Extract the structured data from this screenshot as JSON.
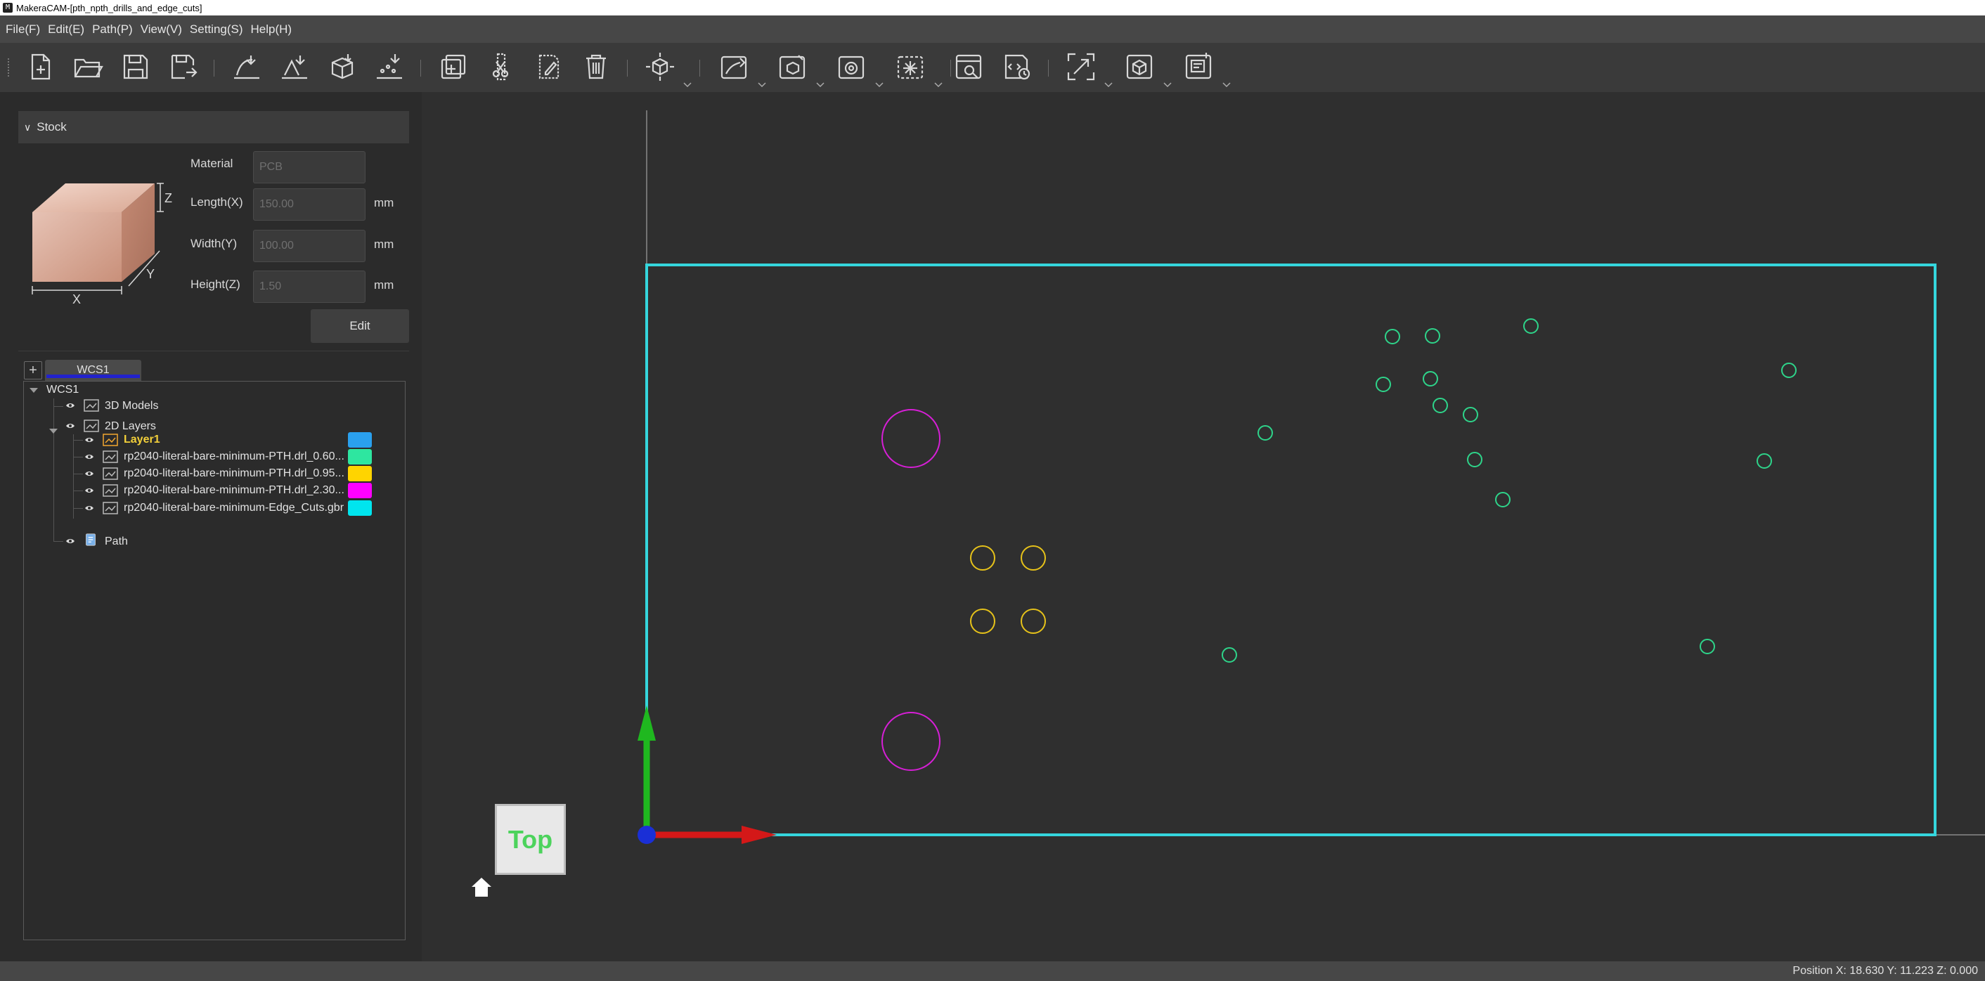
{
  "window": {
    "title": "MakeraCAM-[pth_npth_drills_and_edge_cuts]",
    "icon_label": "M"
  },
  "menu": [
    "File(F)",
    "Edit(E)",
    "Path(P)",
    "View(V)",
    "Setting(S)",
    "Help(H)"
  ],
  "toolbar": {
    "buttons": [
      "new-file",
      "open-file",
      "save",
      "save-as",
      "import-2d",
      "import-arc",
      "import-3d",
      "import-dots",
      "add",
      "cut",
      "edit",
      "delete",
      "transform",
      "2d-path",
      "3d-path",
      "drill",
      "laser",
      "simulate",
      "gcode",
      "fit-view",
      "3d-view",
      "report"
    ]
  },
  "stock": {
    "header": "Stock",
    "axis_labels": {
      "x": "X",
      "y": "Y",
      "z": "Z"
    },
    "fields": [
      {
        "label": "Material",
        "value": "PCB",
        "unit": ""
      },
      {
        "label": "Length(X)",
        "value": "150.00",
        "unit": "mm"
      },
      {
        "label": "Width(Y)",
        "value": "100.00",
        "unit": "mm"
      },
      {
        "label": "Height(Z)",
        "value": "1.50",
        "unit": "mm"
      }
    ],
    "edit_label": "Edit"
  },
  "wcs": {
    "add_label": "+",
    "tab_label": "WCS1"
  },
  "tree": {
    "root": "WCS1",
    "models": "3D Models",
    "layers_group": "2D Layers",
    "layers": [
      {
        "name": "Layer1",
        "color": "#2aa0ee"
      },
      {
        "name": "rp2040-literal-bare-minimum-PTH.drl_0.60...",
        "color": "#2ee6a0"
      },
      {
        "name": "rp2040-literal-bare-minimum-PTH.drl_0.95...",
        "color": "#ffd400"
      },
      {
        "name": "rp2040-literal-bare-minimum-PTH.drl_2.30...",
        "color": "#ff00ff"
      },
      {
        "name": "rp2040-literal-bare-minimum-Edge_Cuts.gbr",
        "color": "#00e5ee"
      }
    ],
    "path": "Path"
  },
  "viewport": {
    "view_label": "Top",
    "edge_color": "#35d6dd",
    "small_holes_color": "#2ed48a",
    "medium_holes_color": "#e6c21a",
    "large_holes_color": "#d61fd6"
  },
  "status": {
    "position": "Position X: 18.630 Y: 11.223 Z: 0.000"
  }
}
